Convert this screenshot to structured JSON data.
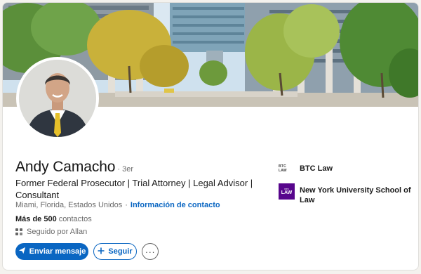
{
  "profile": {
    "name": "Andy Camacho",
    "degree": "· 3er",
    "headline": "Former Federal Prosecutor | Trial Attorney | Legal Advisor | Consultant",
    "location": "Miami, Florida, Estados Unidos",
    "location_separator": "·",
    "contact_link": "Información de contacto",
    "connections_count": "Más de 500",
    "connections_label": "contactos",
    "followed_by": "Seguido por Allan"
  },
  "actions": {
    "message_label": "Enviar mensaje",
    "follow_label": "Seguir",
    "more_label": "···"
  },
  "organizations": [
    {
      "name": "BTC Law",
      "logo_text": "BTC LAW"
    },
    {
      "name": "New York University School of Law",
      "logo_text": "LAW",
      "logo_top_text": "NYU"
    }
  ],
  "colors": {
    "accent": "#0a66c2",
    "nyu_purple": "#57068c",
    "tie": "#e6c02a"
  },
  "icons": {
    "message": "send-icon",
    "follow": "plus-icon",
    "more": "ellipsis-icon",
    "followed": "people-icon"
  }
}
